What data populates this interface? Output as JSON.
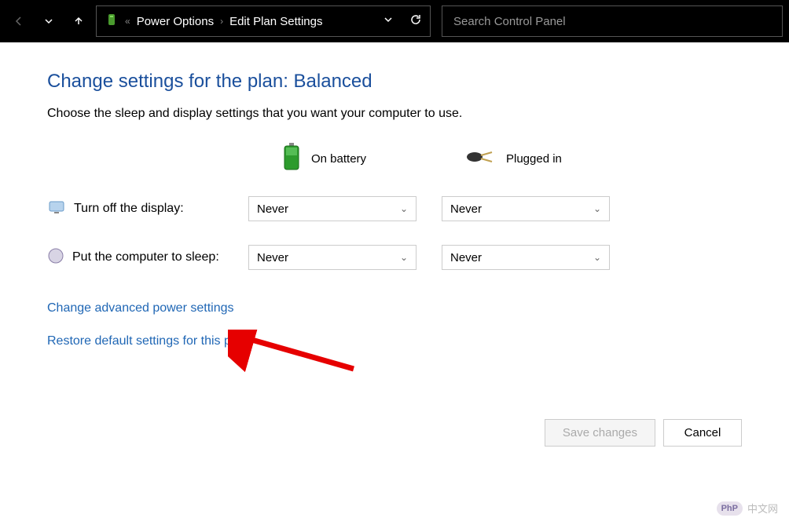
{
  "toolbar": {
    "breadcrumb": [
      "Power Options",
      "Edit Plan Settings"
    ],
    "search_placeholder": "Search Control Panel"
  },
  "page": {
    "title": "Change settings for the plan: Balanced",
    "subtitle": "Choose the sleep and display settings that you want your computer to use."
  },
  "columns": {
    "battery": "On battery",
    "plugged": "Plugged in"
  },
  "rows": {
    "display": {
      "label": "Turn off the display:",
      "battery_value": "Never",
      "plugged_value": "Never"
    },
    "sleep": {
      "label": "Put the computer to sleep:",
      "battery_value": "Never",
      "plugged_value": "Never"
    }
  },
  "links": {
    "advanced": "Change advanced power settings",
    "restore": "Restore default settings for this plan"
  },
  "buttons": {
    "save": "Save changes",
    "cancel": "Cancel"
  },
  "watermark": {
    "badge": "PhP",
    "text": "中文网"
  }
}
